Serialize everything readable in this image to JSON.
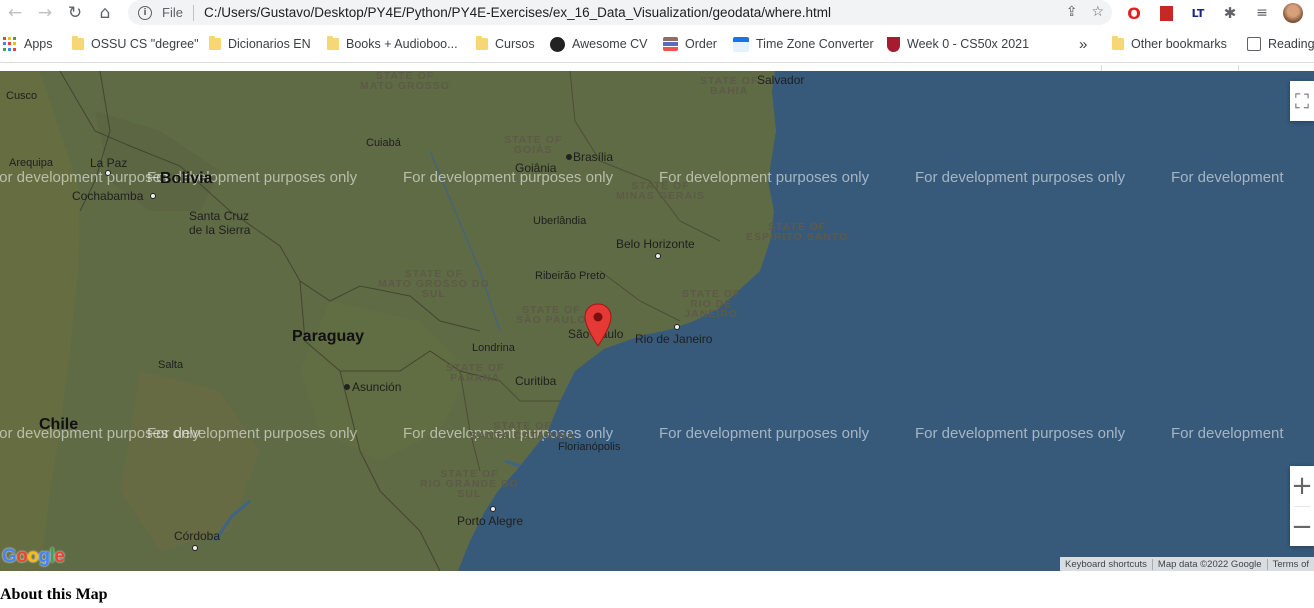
{
  "browser": {
    "file_label": "File",
    "url": "C:/Users/Gustavo/Desktop/PY4E/Python/PY4E-Exercises/ex_16_Data_Visualization/geodata/where.html",
    "nav_icons": [
      "back-icon",
      "forward-icon",
      "reload-icon",
      "home-icon"
    ],
    "omnibox_icons": [
      "info-icon",
      "share-icon",
      "star-icon"
    ],
    "extension_icons": [
      "opera-icon",
      "bookmark-extension-icon",
      "lt-icon",
      "puzzle-icon",
      "reading-list-icon",
      "profile-avatar"
    ]
  },
  "bookmarks": {
    "items": [
      {
        "label": "Apps",
        "icon": "apps-grid-icon"
      },
      {
        "label": "OSSU CS \"degree\"",
        "icon": "folder-icon"
      },
      {
        "label": "Dicionarios EN",
        "icon": "folder-icon"
      },
      {
        "label": "Books + Audioboo...",
        "icon": "folder-icon"
      },
      {
        "label": "Cursos",
        "icon": "folder-icon"
      },
      {
        "label": "Awesome CV",
        "icon": "github-icon"
      },
      {
        "label": "Order",
        "icon": "stack-icon"
      },
      {
        "label": "Time Zone Converter",
        "icon": "calendar-icon"
      },
      {
        "label": "Week 0 - CS50x 2021",
        "icon": "harvard-icon"
      }
    ],
    "more": "»",
    "other": "Other bookmarks",
    "reading": "Reading"
  },
  "map": {
    "cities": [
      "Cusco",
      "La Paz",
      "Arequipa",
      "Cochabamba",
      "Santa Cruz de la Sierra",
      "Cuiabá",
      "Goiânia",
      "Brasília",
      "Uberlândia",
      "Belo Horizonte",
      "Ribeirão Preto",
      "São Paulo",
      "Rio de Janeiro",
      "Londrina",
      "Curitiba",
      "Asunción",
      "Salta",
      "Florianópolis",
      "Porto Alegre",
      "Córdoba",
      "Salvador"
    ],
    "countries": [
      "Bolivia",
      "Paraguay",
      "Chile"
    ],
    "states": [
      "STATE OF MATO GROSSO",
      "STATE OF BAHIA",
      "STATE OF GOIÁS",
      "STATE OF MINAS GERAIS",
      "STATE OF ESPÍRITO SANTO",
      "STATE OF MATO GROSSO DO SUL",
      "STATE OF SÃO PAULO",
      "STATE OF RIO DE JANEIRO",
      "STATE OF PARANÁ",
      "STATE OF SANTA CATARINA",
      "STATE OF RIO GRANDE DO SUL"
    ],
    "watermark": "For development purposes only",
    "marker": {
      "city": "São Paulo",
      "color": "#e53935"
    },
    "controls": {
      "fullscreen": "fullscreen-icon",
      "zoom_in": "+",
      "zoom_out": "−"
    },
    "attribution": [
      "Keyboard shortcuts",
      "Map data ©2022 Google",
      "Terms of"
    ],
    "logo": "Google",
    "colors": {
      "water": "#37597a",
      "land": "#5f6b45",
      "marker": "#e53935"
    }
  },
  "page": {
    "heading": "About this Map"
  }
}
